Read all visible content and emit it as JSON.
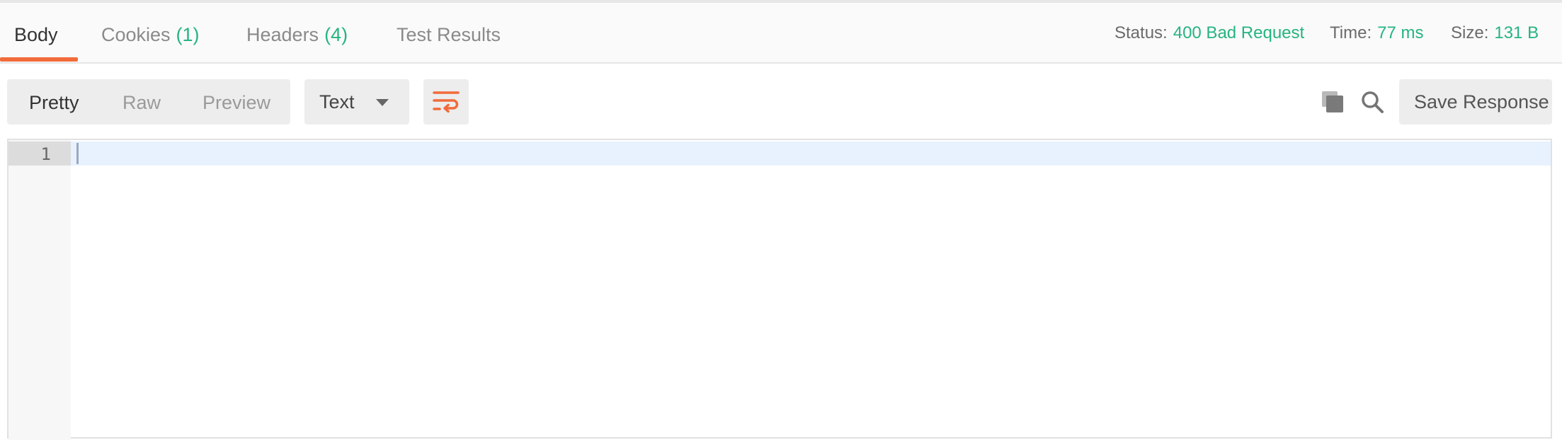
{
  "tabs": [
    {
      "label": "Body",
      "count": ""
    },
    {
      "label": "Cookies",
      "count": "(1)"
    },
    {
      "label": "Headers",
      "count": "(4)"
    },
    {
      "label": "Test Results",
      "count": ""
    }
  ],
  "status": {
    "status_label": "Status:",
    "status_value": "400 Bad Request",
    "time_label": "Time:",
    "time_value": "77 ms",
    "size_label": "Size:",
    "size_value": "131 B"
  },
  "view_modes": [
    "Pretty",
    "Raw",
    "Preview"
  ],
  "active_view_mode": "Pretty",
  "format_dropdown": {
    "selected": "Text"
  },
  "icons": {
    "wrap": "wrap-lines-icon",
    "copy": "copy-icon",
    "search": "search-icon",
    "caret": "chevron-down-icon"
  },
  "save_response_label": "Save Response",
  "editor": {
    "line_numbers": [
      "1"
    ],
    "content": ""
  },
  "colors": {
    "accent": "#f26b3a",
    "success": "#26b47f"
  }
}
